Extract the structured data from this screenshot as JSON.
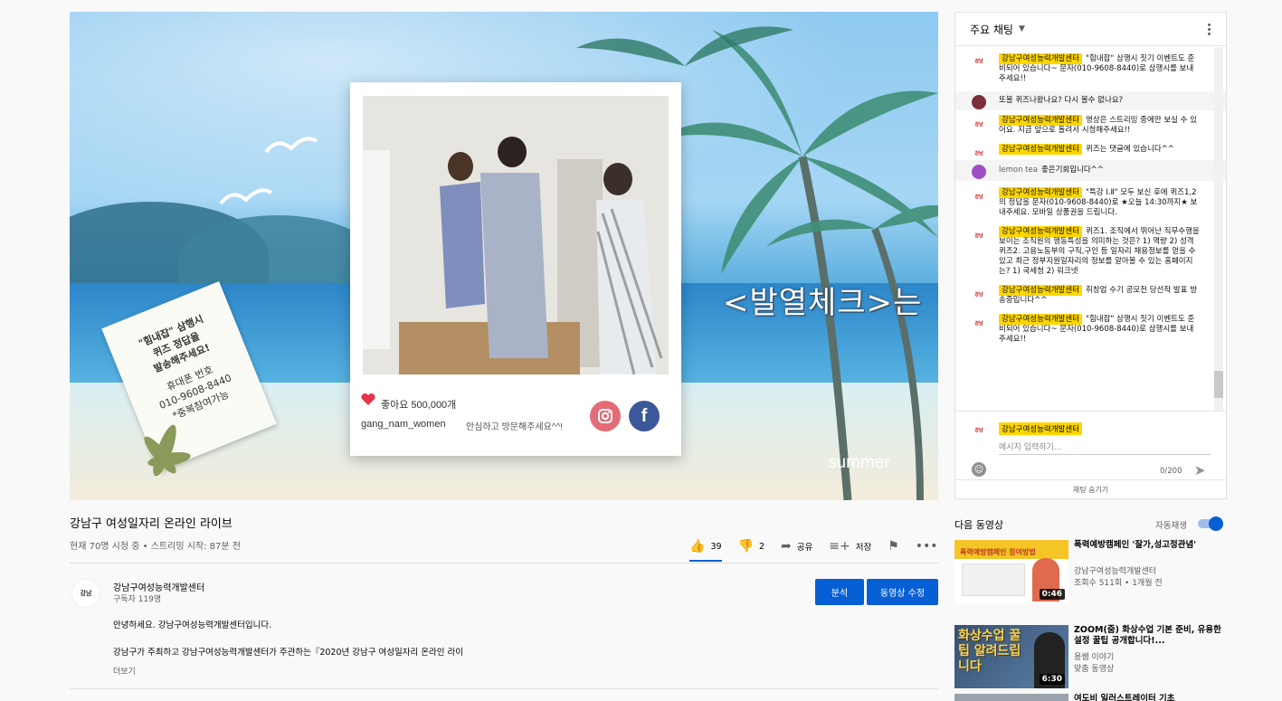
{
  "video": {
    "overlay_text": "<발열체크>는",
    "summer": "summer",
    "frame": {
      "likes": "좋아요 500,000개",
      "user": "gang_nam_women",
      "message": "안심하고 방문해주세요^^!"
    },
    "note_lines": [
      "\"힘내잡\" 삼행시",
      "퀴즈 정답을",
      "발송해주세요!",
      "휴대폰 번호",
      "010-9608-8440",
      "*중복참여가능"
    ]
  },
  "chat": {
    "header": "주요 채팅",
    "messages": [
      {
        "author": "강남구여성능력개발센터",
        "text": "\"힘내잡\" 삼행시 짓기 이벤트도 준비되어 있습니다~ 문자(010-9608-8440)로 삼행시를 보내주세요!!",
        "highlight": false,
        "avatar": "강남"
      },
      {
        "author": "",
        "text": "또볼 퀴즈나왔나요? 다시 볼수 없나요?",
        "highlight": true,
        "avatar": ""
      },
      {
        "author": "강남구여성능력개발센터",
        "text": "영상은 스트리밍 중에만 보실 수 있어요. 지금 앞으로 돌려서 시청해주세요!!",
        "highlight": false,
        "avatar": "강남"
      },
      {
        "author": "강남구여성능력개발센터",
        "text": "퀴즈는 댓글에 있습니다^^",
        "highlight": false,
        "avatar": "강남"
      },
      {
        "author_plain": "lemon tea",
        "text": "좋은기회입니다^^",
        "highlight": true,
        "avatar": ""
      },
      {
        "author": "강남구여성능력개발센터",
        "text": "\"특강 Ⅰ.Ⅱ\" 모두 보신 후에 퀴즈1,2의 정답을 문자(010-9608-8440)로 ★오늘 14:30까지★ 보내주세요. 모바일 상품권을 드립니다.",
        "highlight": false,
        "avatar": "강남"
      },
      {
        "author": "강남구여성능력개발센터",
        "text": "퀴즈1. 조직에서 뛰어난 직무수행을 보이는 조직원의 행동특성을 의미하는 것은? 1) 역량 2) 성격 퀴즈2. 고용노동부의 구직,구인 등 일자리 채용정보를 얻을 수 있고 최근 정부지원일자리의 정보를 알아볼 수 있는 홈페이지는? 1) 국세청 2) 워크넷",
        "highlight": false,
        "avatar": "강남"
      },
      {
        "author": "강남구여성능력개발센터",
        "text": "취창업 수기 공모전 당선작 발표 방송중입니다^^",
        "highlight": false,
        "avatar": "강남"
      },
      {
        "author": "강남구여성능력개발센터",
        "text": "\"힘내잡\" 삼행시 짓기 이벤트도 준비되어 있습니다~ 문자(010-9608-8440)로 삼행시를 보내주세요!!",
        "highlight": false,
        "avatar": "강남"
      }
    ],
    "input_author": "강남구여성능력개발센터",
    "input_placeholder": "메시지 입력하기...",
    "counter": "0/200",
    "hide_chat": "채팅 숨기기"
  },
  "info": {
    "title": "강남구 여성일자리 온라인 라이브",
    "views": "현재 70명 시청 중 • 스트리밍 시작: 87분 전",
    "likes": "39",
    "dislikes": "2",
    "share": "공유",
    "save": "저장",
    "channel": "강남구여성능력개발센터",
    "subscribers": "구독자 119명",
    "analytics_button": "분석",
    "edit_button": "동영상 수정",
    "desc_line1": "안녕하세요. 강남구여성능력개발센터입니다.",
    "desc_line2": "강남구가 주최하고 강남구여성능력개발센터가 주관하는『2020년 강남구 여성일자리 온라인 라이",
    "more": "더보기"
  },
  "upnext": {
    "label": "다음 동영상",
    "autoplay": "자동재생",
    "items": [
      {
        "title": "폭력예방캠페인 '잘가,성고정관념'",
        "channel": "강남구여성능력개발센터",
        "meta": "조회수 511회 • 1개월 전",
        "duration": "0:46",
        "thumb_text": "폭력예방캠페인 참여방법"
      },
      {
        "title": "ZOOM(줌) 화상수업 기본 준비, 유용한 설정 꿀팁 공개합니다!...",
        "channel": "용쌤 이야기",
        "meta": "맞춤 동영상",
        "duration": "6:30",
        "thumb_text": "화상수업 꿀팁 알려드립니다"
      },
      {
        "title": "여도비 일러스트레이터 기초",
        "channel": "",
        "meta": "",
        "duration": "",
        "thumb_text": ""
      }
    ]
  },
  "colors": {
    "accent": "#065fd4",
    "author_highlight": "#ffd600"
  }
}
